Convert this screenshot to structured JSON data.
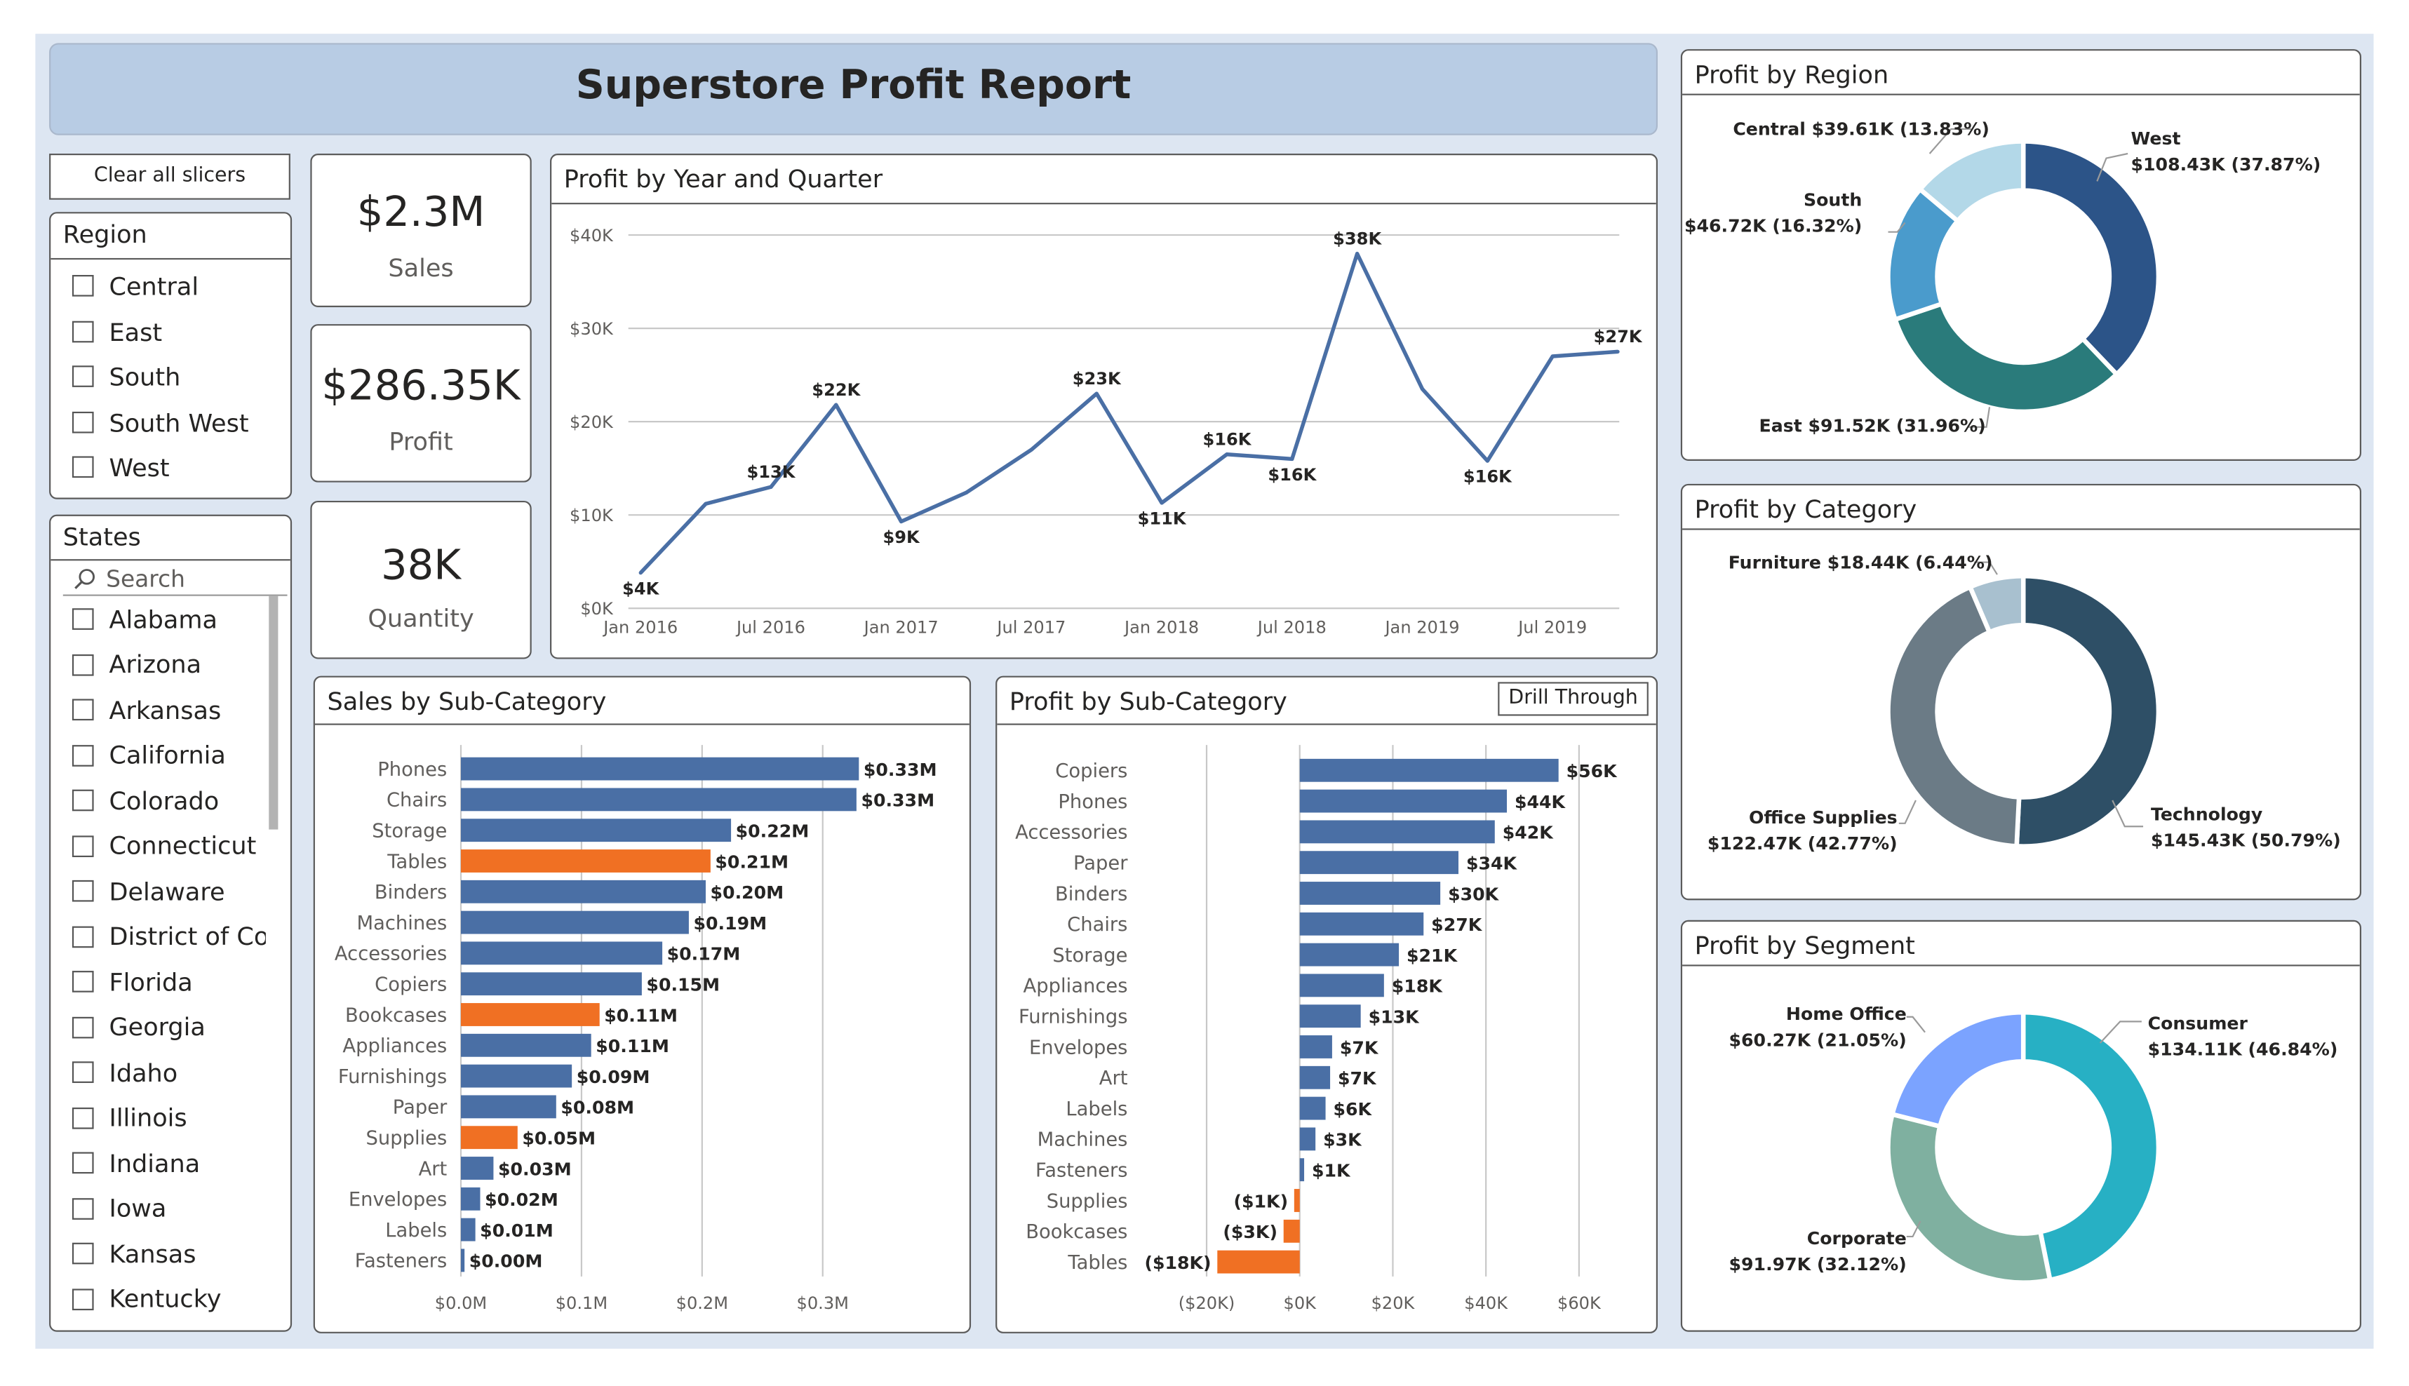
{
  "report": {
    "title": "Superstore Profit Report"
  },
  "buttons": {
    "clear_slicers": "Clear all slicers",
    "drill_through": "Drill Through"
  },
  "region_slicer": {
    "title": "Region",
    "items": [
      "Central",
      "East",
      "South",
      "South West",
      "West"
    ]
  },
  "states_slicer": {
    "title": "States",
    "search_placeholder": "Search",
    "items": [
      "Alabama",
      "Arizona",
      "Arkansas",
      "California",
      "Colorado",
      "Connecticut",
      "Delaware",
      "District of Co...",
      "Florida",
      "Georgia",
      "Idaho",
      "Illinois",
      "Indiana",
      "Iowa",
      "Kansas",
      "Kentucky"
    ]
  },
  "kpis": [
    {
      "value": "$2.3M",
      "label": "Sales"
    },
    {
      "value": "$286.35K",
      "label": "Profit"
    },
    {
      "value": "38K",
      "label": "Quantity"
    }
  ],
  "colors": {
    "bar_blue": "#4a6fa5",
    "bar_orange": "#f07023",
    "line": "#4a6fa5",
    "region": [
      "#2c5488",
      "#2a7b7b",
      "#4a9bcc",
      "#b3d8e8"
    ],
    "category": [
      "#2e4f66",
      "#6b7b86",
      "#a8c0cf"
    ],
    "segment": [
      "#27b0c4",
      "#7fb0a0",
      "#7ba3ff"
    ]
  },
  "chart_data": [
    {
      "type": "line",
      "title": "Profit by Year and Quarter",
      "x": [
        "2016-Q1",
        "2016-Q2",
        "2016-Q3",
        "2016-Q4",
        "2017-Q1",
        "2017-Q2",
        "2017-Q3",
        "2017-Q4",
        "2018-Q1",
        "2018-Q2",
        "2018-Q3",
        "2018-Q4",
        "2019-Q1",
        "2019-Q2",
        "2019-Q3",
        "2019-Q4"
      ],
      "values": [
        3.8,
        11.2,
        13.0,
        21.8,
        9.3,
        12.4,
        17.0,
        23.0,
        11.3,
        16.5,
        16.0,
        38.0,
        23.5,
        15.8,
        27.0,
        27.5
      ],
      "data_labels": {
        "0": "$4K",
        "2": "$13K",
        "3": "$22K",
        "4": "$9K",
        "7": "$23K",
        "8": "$11K",
        "9": "$16K",
        "10": "$16K",
        "11": "$38K",
        "13": "$16K",
        "15": "$27K"
      },
      "yticks": [
        "$0K",
        "$10K",
        "$20K",
        "$30K",
        "$40K"
      ],
      "xticks": [
        "Jan 2016",
        "Jul 2016",
        "Jan 2017",
        "Jul 2017",
        "Jan 2018",
        "Jul 2018",
        "Jan 2019",
        "Jul 2019"
      ],
      "ylim": [
        0,
        40
      ],
      "grid": true
    },
    {
      "type": "bar",
      "orientation": "horizontal",
      "title": "Sales by Sub-Category",
      "categories": [
        "Phones",
        "Chairs",
        "Storage",
        "Tables",
        "Binders",
        "Machines",
        "Accessories",
        "Copiers",
        "Bookcases",
        "Appliances",
        "Furnishings",
        "Paper",
        "Supplies",
        "Art",
        "Envelopes",
        "Labels",
        "Fasteners"
      ],
      "values": [
        0.33,
        0.328,
        0.224,
        0.207,
        0.203,
        0.189,
        0.167,
        0.15,
        0.115,
        0.108,
        0.092,
        0.079,
        0.047,
        0.027,
        0.016,
        0.012,
        0.003
      ],
      "labels": [
        "$0.33M",
        "$0.33M",
        "$0.22M",
        "$0.21M",
        "$0.20M",
        "$0.19M",
        "$0.17M",
        "$0.15M",
        "$0.11M",
        "$0.11M",
        "$0.09M",
        "$0.08M",
        "$0.05M",
        "$0.03M",
        "$0.02M",
        "$0.01M",
        "$0.00M"
      ],
      "highlight": [
        "Tables",
        "Bookcases",
        "Supplies"
      ],
      "xticks": [
        "$0.0M",
        "$0.1M",
        "$0.2M",
        "$0.3M"
      ],
      "xlim": [
        0,
        0.33
      ],
      "grid": true
    },
    {
      "type": "bar",
      "orientation": "horizontal",
      "title": "Profit by Sub-Category",
      "categories": [
        "Copiers",
        "Phones",
        "Accessories",
        "Paper",
        "Binders",
        "Chairs",
        "Storage",
        "Appliances",
        "Furnishings",
        "Envelopes",
        "Art",
        "Labels",
        "Machines",
        "Fasteners",
        "Supplies",
        "Bookcases",
        "Tables"
      ],
      "values": [
        55.6,
        44.5,
        41.9,
        34.1,
        30.2,
        26.6,
        21.3,
        18.1,
        13.1,
        6.96,
        6.53,
        5.55,
        3.38,
        0.95,
        -1.19,
        -3.47,
        -17.7
      ],
      "labels": [
        "$56K",
        "$44K",
        "$42K",
        "$34K",
        "$30K",
        "$27K",
        "$21K",
        "$18K",
        "$13K",
        "$7K",
        "$7K",
        "$6K",
        "$3K",
        "$1K",
        "($1K)",
        "($3K)",
        "($18K)"
      ],
      "xticks": [
        "($20K)",
        "$0K",
        "$20K",
        "$40K",
        "$60K"
      ],
      "xlim": [
        -20,
        60
      ],
      "grid": true
    },
    {
      "type": "pie",
      "donut": true,
      "title": "Profit by Region",
      "categories": [
        "West",
        "East",
        "South",
        "Central"
      ],
      "values": [
        37.87,
        31.96,
        16.32,
        13.83
      ],
      "labels": [
        "West|$108.43K (37.87%)",
        "East $91.52K (31.96%)",
        "South|$46.72K (16.32%)",
        "Central $39.61K (13.83%)"
      ]
    },
    {
      "type": "pie",
      "donut": true,
      "title": "Profit by Category",
      "categories": [
        "Technology",
        "Office Supplies",
        "Furniture"
      ],
      "values": [
        50.79,
        42.77,
        6.44
      ],
      "labels": [
        "Technology|$145.43K (50.79%)",
        "Office Supplies|$122.47K (42.77%)",
        "Furniture $18.44K (6.44%)"
      ]
    },
    {
      "type": "pie",
      "donut": true,
      "title": "Profit by Segment",
      "categories": [
        "Consumer",
        "Corporate",
        "Home Office"
      ],
      "values": [
        46.84,
        32.12,
        21.05
      ],
      "labels": [
        "Consumer|$134.11K (46.84%)",
        "Corporate|$91.97K (32.12%)",
        "Home Office|$60.27K (21.05%)"
      ]
    }
  ]
}
